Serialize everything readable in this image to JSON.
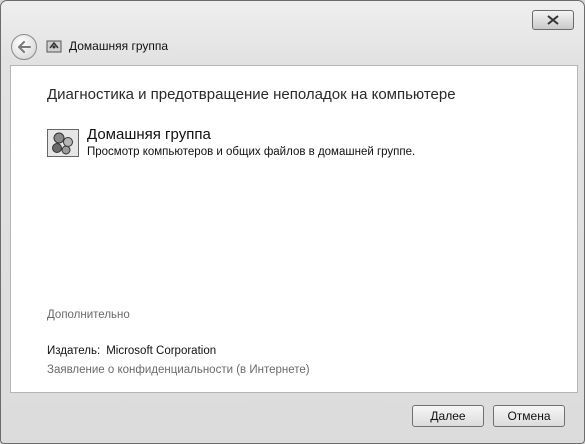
{
  "window": {
    "title": "Домашняя группа",
    "close_icon": "close-icon",
    "back_icon": "back-arrow-icon"
  },
  "main": {
    "heading": "Диагностика и предотвращение неполадок на компьютере",
    "item": {
      "icon": "homegroup-icon",
      "title": "Домашняя группа",
      "description": "Просмотр компьютеров и общих файлов в домашней группе."
    },
    "advanced_link": "Дополнительно",
    "publisher_label": "Издатель:",
    "publisher_value": "Microsoft Corporation",
    "privacy_link": "Заявление о конфиденциальности (в Интернете)"
  },
  "buttons": {
    "next": "Далее",
    "cancel": "Отмена"
  }
}
